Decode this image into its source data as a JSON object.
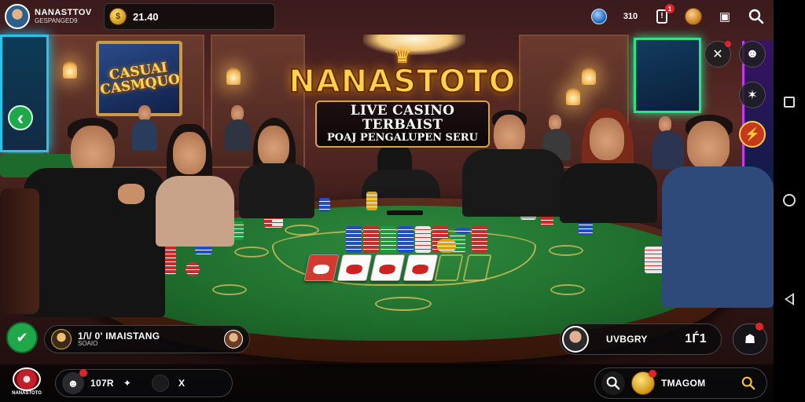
{
  "player": {
    "name": "NANASTTOV",
    "subtitle": "GESPANGED9"
  },
  "wallet": {
    "amount": "21.40",
    "coin_glyph": "$"
  },
  "top_icons": [
    {
      "name": "globe-icon",
      "glyph": "◉",
      "label": ""
    },
    {
      "name": "stats-icon",
      "glyph": "",
      "label": "310"
    },
    {
      "name": "alert-icon",
      "glyph": "!",
      "label": "",
      "badge": "1"
    },
    {
      "name": "bonus-icon",
      "glyph": "",
      "label": ""
    },
    {
      "name": "bag-icon",
      "glyph": "▣",
      "label": ""
    },
    {
      "name": "search-icon",
      "glyph": "⌕",
      "label": ""
    }
  ],
  "logo": {
    "brand": "NANASTOTO",
    "tagline_1": "LIVE CASINO TERBAIST",
    "tagline_2": "POAJ PENGALUPEN SERU"
  },
  "wall_sign": {
    "text": "CASUAI CASMQUO"
  },
  "side_buttons": [
    {
      "name": "tools-button",
      "glyph": "✕",
      "badge": ""
    },
    {
      "name": "profile-button",
      "glyph": "☻",
      "badge": ""
    },
    {
      "name": "effects-button",
      "glyph": "✶",
      "badge": ""
    },
    {
      "name": "promo-button",
      "glyph": "⚡",
      "badge": ""
    }
  ],
  "left_arrow": "‹",
  "check_glyph": "✔",
  "chat_pill": {
    "text": "1/\\/ 0' IMAISTANG",
    "sub": "SOAIO"
  },
  "bottom_left": {
    "count": "107R",
    "misc": "X"
  },
  "dealer_pill": {
    "name": "UVBGRY",
    "value": "1Ѓ1"
  },
  "lobby_pill": {
    "label": "TMAGOM"
  },
  "brand_small": "NANASTOTO",
  "colors": {
    "felt": "#1f6e2d",
    "gold": "#ffd34d",
    "badge_red": "#e0242b",
    "accent_green": "#1fa84a"
  }
}
